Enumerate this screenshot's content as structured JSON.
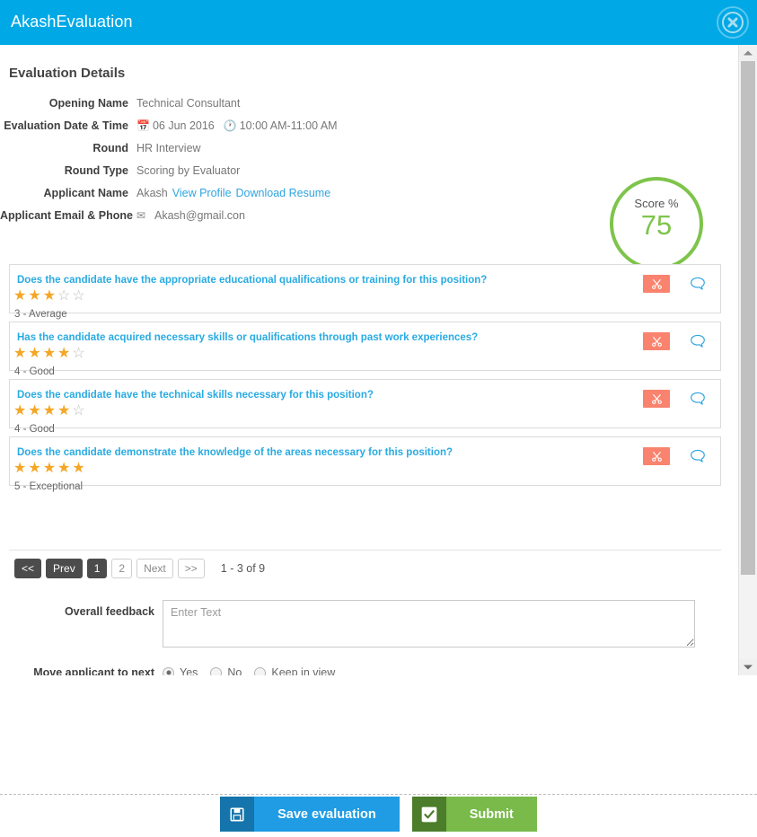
{
  "window": {
    "title": "AkashEvaluation",
    "close_icon": "close-circle-icon"
  },
  "details": {
    "heading": "Evaluation Details",
    "rows": [
      {
        "label": "Opening Name",
        "value": "Technical Consultant"
      },
      {
        "label": "Evaluation Date & Time",
        "date_icon": "calendar-icon",
        "date": "06 Jun 2016",
        "time_icon": "clock-icon",
        "time": "10:00 AM-11:00 AM"
      },
      {
        "label": "Round",
        "value": "HR Interview"
      },
      {
        "label": "Round Type",
        "value": "Scoring by Evaluator"
      },
      {
        "label": "Applicant Name",
        "value": "Akash",
        "link1": "View Profile",
        "link2": "Download Resume"
      },
      {
        "label": "Applicant Email & Phone",
        "mail_icon": "envelope-icon",
        "value": "Akash@gmail.con"
      }
    ]
  },
  "score": {
    "label": "Score %",
    "value": "75",
    "ring_color": "#7ec44b"
  },
  "questions": [
    {
      "text": "Does the candidate have the appropriate educational qualifications or training for this position?",
      "rating": 3,
      "max_rating": 5,
      "rating_text": "3 - Average",
      "cut_icon": "scissors-icon",
      "comment_icon": "comment-bubble-icon"
    },
    {
      "text": "Has the candidate acquired necessary skills or qualifications through past work experiences?",
      "rating": 4,
      "max_rating": 5,
      "rating_text": "4 - Good",
      "cut_icon": "scissors-icon",
      "comment_icon": "comment-bubble-icon"
    },
    {
      "text": "Does the candidate have the technical skills necessary for this position?",
      "rating": 4,
      "max_rating": 5,
      "rating_text": "4 - Good",
      "cut_icon": "scissors-icon",
      "comment_icon": "comment-bubble-icon"
    },
    {
      "text": "Does the candidate demonstrate the knowledge of the areas necessary for this position?",
      "rating": 5,
      "max_rating": 5,
      "rating_text": "5 - Exceptional",
      "cut_icon": "scissors-icon",
      "comment_icon": "comment-bubble-icon"
    }
  ],
  "pagination": {
    "first": "<<",
    "prev": "Prev",
    "pages": [
      "1",
      "2"
    ],
    "active_page": "1",
    "next": "Next",
    "last": ">>",
    "info": "1 - 3 of 9"
  },
  "feedback": {
    "label": "Overall feedback",
    "value": "",
    "placeholder": "Enter Text"
  },
  "move_applicant": {
    "label": "Move applicant to next",
    "options": [
      {
        "text": "Yes",
        "checked": true
      },
      {
        "text": "No",
        "checked": false
      },
      {
        "text": "Keep in view",
        "checked": false
      }
    ]
  },
  "footer": {
    "save": {
      "label": "Save evaluation",
      "icon": "floppy-disk-icon",
      "color": "#1f9ce4"
    },
    "submit": {
      "label": "Submit",
      "icon": "check-square-icon",
      "color": "#79ba4b"
    }
  },
  "scrollbar": {
    "up_icon": "triangle-up-icon",
    "down_icon": "triangle-down-icon"
  }
}
